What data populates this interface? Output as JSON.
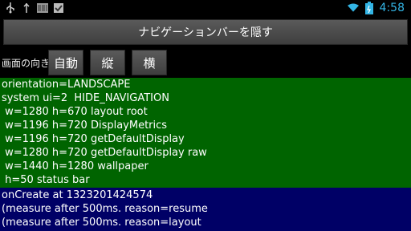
{
  "status_bar": {
    "time": "4:58",
    "left_icons": [
      "usb-icon",
      "debug-icon",
      "barcode-icon",
      "checklist-icon"
    ],
    "right_icons": [
      "wifi-icon",
      "battery-icon"
    ]
  },
  "nav": {
    "hide_button_label": "ナビゲーションバーを隠す"
  },
  "orientation": {
    "label": "画面の向き",
    "buttons": [
      "自動",
      "縦",
      "横"
    ]
  },
  "info": {
    "lines": [
      "orientation=LANDSCAPE",
      "system ui=2  HIDE_NAVIGATION",
      " w=1280 h=670 layout root",
      " w=1196 h=720 DisplayMetrics",
      " w=1196 h=720 getDefaultDisplay",
      " w=1280 h=720 getDefaultDisplay raw",
      " w=1440 h=1280 wallpaper",
      " h=50 status bar"
    ]
  },
  "log": {
    "lines": [
      "onCreate at 1323201424574",
      "(measure after 500ms. reason=resume",
      "(measure after 500ms. reason=layout"
    ]
  },
  "colors": {
    "time": "#33b5e5",
    "info_bg": "#006400",
    "log_bg": "#000066"
  }
}
